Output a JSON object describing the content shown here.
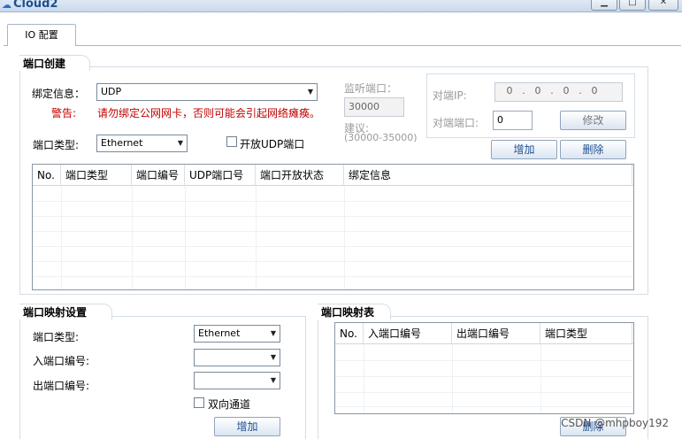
{
  "window": {
    "title": "Cloud2",
    "minimize_glyph": "▁",
    "maximize_glyph": "□",
    "close_glyph": "✕",
    "app_icon": "cloud-icon"
  },
  "tabs": [
    {
      "label": "IO 配置"
    }
  ],
  "port_create": {
    "title": "端口创建",
    "bind_label": "绑定信息：",
    "bind_value": "UDP",
    "warning_label": "警告:",
    "warning_text": "请勿绑定公网网卡，否则可能会引起网络瘫痪。",
    "port_type_label": "端口类型:",
    "port_type_value": "Ethernet",
    "open_udp_label": "开放UDP端口",
    "listen_port_label": "监听端口：",
    "listen_port_value": "30000",
    "suggest_label": "建议:",
    "suggest_range": "(30000-35000)",
    "peer_ip_label": "对端IP:",
    "peer_ip": [
      "0",
      "0",
      "0",
      "0"
    ],
    "peer_port_label": "对端端口:",
    "peer_port_value": "0",
    "modify_button": "修改",
    "add_button": "增加",
    "delete_button": "删除",
    "table_headers": [
      "No.",
      "端口类型",
      "端口编号",
      "UDP端口号",
      "端口开放状态",
      "绑定信息"
    ]
  },
  "port_mapping_settings": {
    "title": "端口映射设置",
    "port_type_label": "端口类型:",
    "port_type_value": "Ethernet",
    "in_port_label": "入端口编号:",
    "in_port_value": "",
    "out_port_label": "出端口编号:",
    "out_port_value": "",
    "bidirectional_label": "双向通道",
    "add_button": "增加"
  },
  "port_mapping_table": {
    "title": "端口映射表",
    "table_headers": [
      "No.",
      "入端口编号",
      "出端口编号",
      "端口类型"
    ],
    "delete_button": "删除"
  },
  "watermark": "CSDN @mhpboy192"
}
